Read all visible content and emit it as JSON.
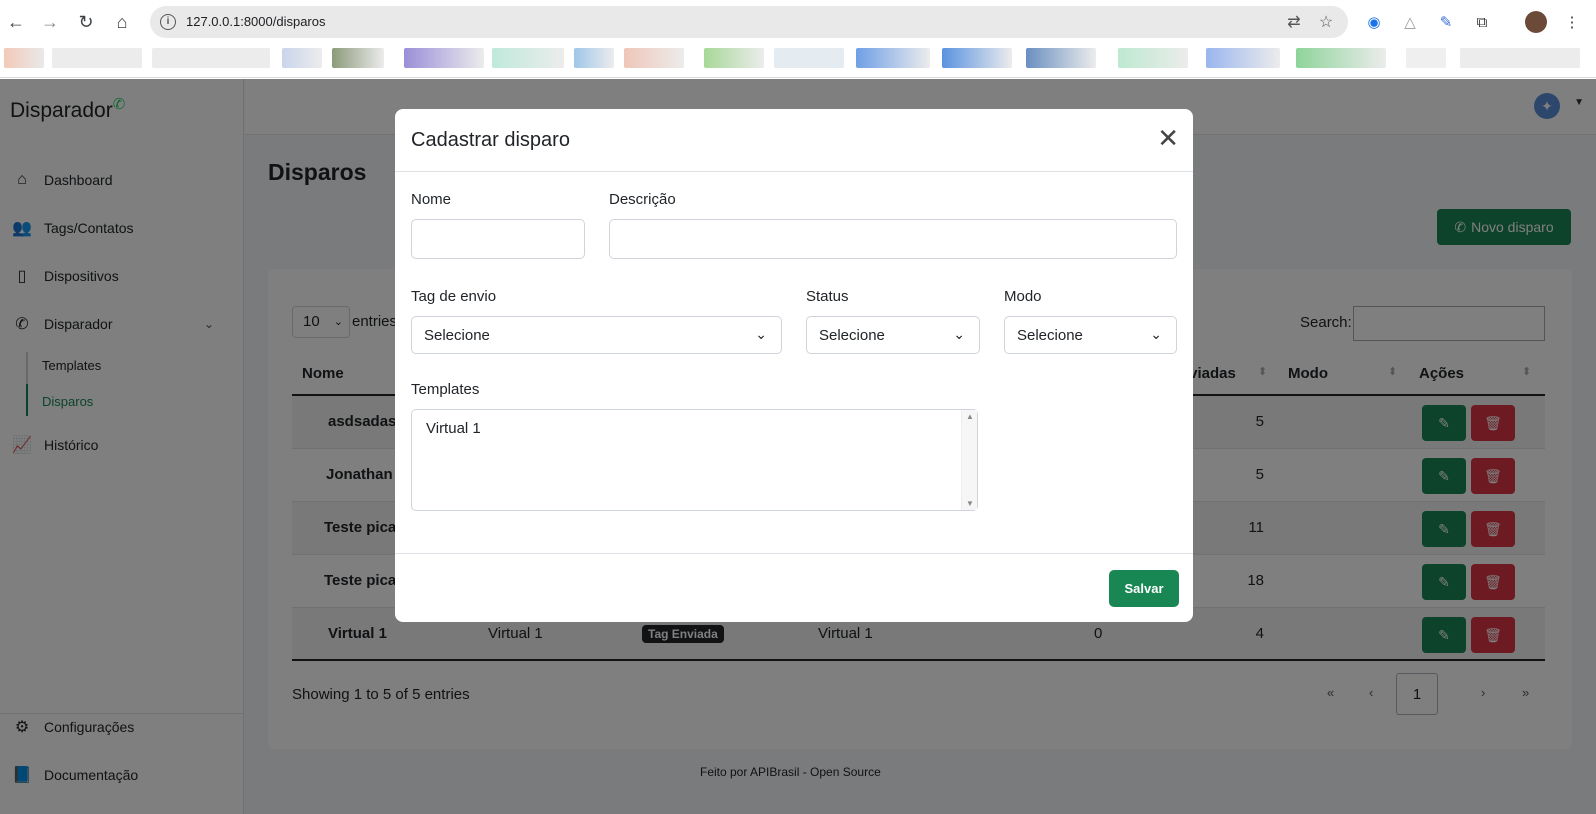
{
  "browser": {
    "url": "127.0.0.1:8000/disparos",
    "back_icon": "arrow-left-icon",
    "forward_icon": "arrow-right-icon",
    "reload_icon": "reload-icon",
    "home_icon": "home-icon"
  },
  "app": {
    "brand": "Disparador",
    "sidebar": {
      "items": [
        {
          "label": "Dashboard",
          "icon": "home-icon"
        },
        {
          "label": "Tags/Contatos",
          "icon": "users-icon"
        },
        {
          "label": "Dispositivos",
          "icon": "mobile-icon"
        },
        {
          "label": "Disparador",
          "icon": "whatsapp-icon"
        },
        {
          "label": "Histórico",
          "icon": "chart-line-icon"
        }
      ],
      "sub_items": [
        {
          "label": "Templates"
        },
        {
          "label": "Disparos",
          "active": true
        }
      ],
      "bottom_items": [
        {
          "label": "Configurações",
          "icon": "gear-icon"
        },
        {
          "label": "Documentação",
          "icon": "book-icon"
        }
      ]
    },
    "page_title": "Disparos",
    "new_button": "Novo disparo",
    "table": {
      "length_value": "10",
      "length_label": "entries",
      "search_label": "Search:",
      "columns": [
        "Nome",
        "Enviadas",
        "Modo",
        "Ações"
      ],
      "rows": [
        {
          "nome": "asdsadas",
          "enviadas": "5"
        },
        {
          "nome": "Jonathan",
          "enviadas": "5"
        },
        {
          "nome": "Teste pica",
          "enviadas": "11"
        },
        {
          "nome": "Teste pica",
          "enviadas": "18"
        },
        {
          "nome": "Virtual 1",
          "descricao": "Virtual 1",
          "tag": "Tag Enviada",
          "template": "Virtual 1",
          "col5": "0",
          "enviadas": "4"
        }
      ],
      "showing": "Showing 1 to 5 of 5 entries",
      "pagination": [
        "«",
        "‹",
        "1",
        "›",
        "»"
      ]
    },
    "footer": "Feito por APIBrasil - Open Source"
  },
  "modal": {
    "title": "Cadastrar disparo",
    "fields": {
      "nome_label": "Nome",
      "descricao_label": "Descrição",
      "tag_label": "Tag de envio",
      "tag_value": "Selecione",
      "status_label": "Status",
      "status_value": "Selecione",
      "modo_label": "Modo",
      "modo_value": "Selecione",
      "templates_label": "Templates",
      "templates_options": [
        "Virtual 1"
      ]
    },
    "save_button": "Salvar"
  },
  "colors": {
    "primary_green": "#198754",
    "danger_red": "#dc3545",
    "whatsapp_green": "#25d366"
  }
}
